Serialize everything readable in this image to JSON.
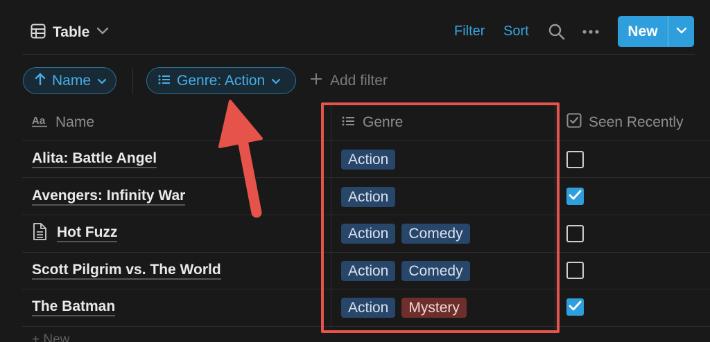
{
  "header": {
    "view_label": "Table",
    "filter_label": "Filter",
    "sort_label": "Sort",
    "new_label": "New"
  },
  "filters": {
    "sort_pill": "Name",
    "genre_pill": "Genre: Action",
    "add_filter": "Add filter"
  },
  "columns": {
    "name": "Name",
    "genre": "Genre",
    "seen": "Seen Recently"
  },
  "rows": [
    {
      "name": "Alita: Battle Angel",
      "tags": [
        "Action"
      ],
      "seen": false,
      "has_page_icon": false
    },
    {
      "name": "Avengers: Infinity War",
      "tags": [
        "Action"
      ],
      "seen": true,
      "has_page_icon": false
    },
    {
      "name": "Hot Fuzz",
      "tags": [
        "Action",
        "Comedy"
      ],
      "seen": false,
      "has_page_icon": true
    },
    {
      "name": "Scott Pilgrim vs. The World",
      "tags": [
        "Action",
        "Comedy"
      ],
      "seen": false,
      "has_page_icon": false
    },
    {
      "name": "The Batman",
      "tags": [
        "Action",
        "Mystery"
      ],
      "seen": true,
      "has_page_icon": false
    }
  ],
  "footer": {
    "new_row": "+ New"
  },
  "colors": {
    "accent": "#2e9fdc",
    "tag_action": "#28456a",
    "tag_mystery": "#6e2f2c",
    "annotation": "#e5534b"
  }
}
